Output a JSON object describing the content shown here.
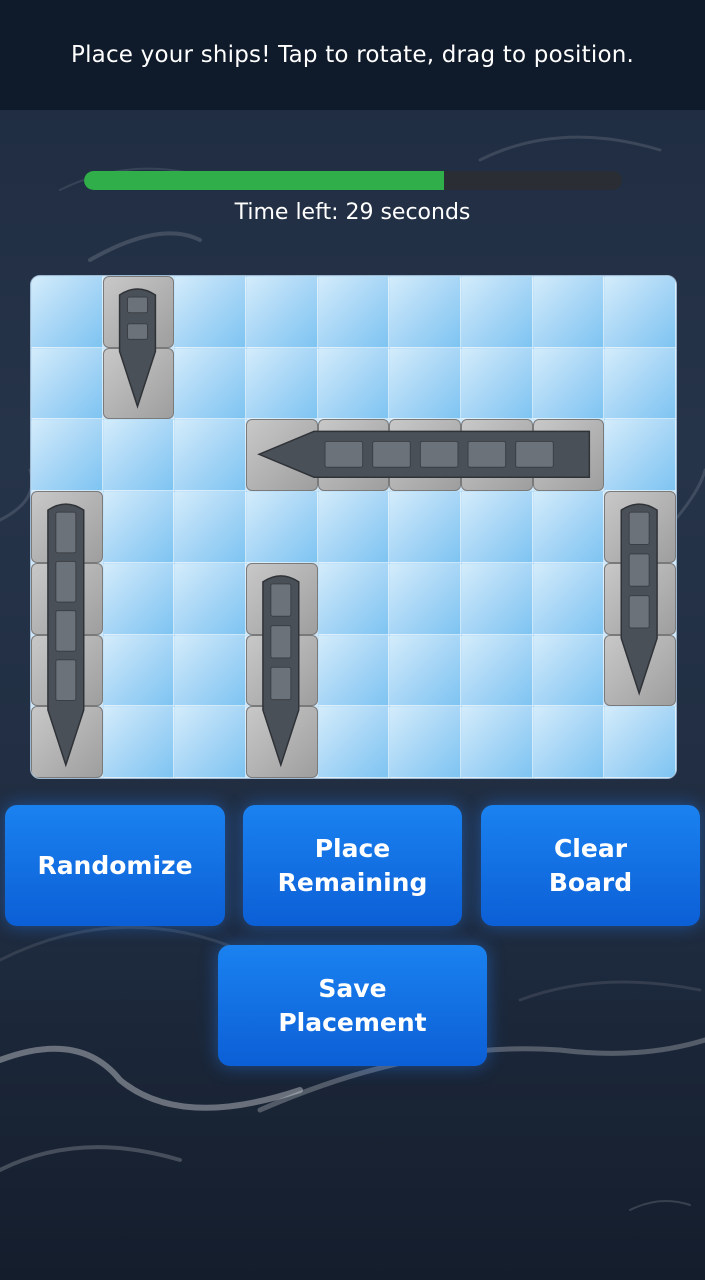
{
  "header": {
    "instruction": "Place your ships! Tap to rotate, drag to position."
  },
  "timer": {
    "label": "Time left: 29 seconds",
    "remaining_fraction": 0.67
  },
  "board": {
    "columns": 9,
    "rows": 7,
    "ships": [
      {
        "name": "patrol-boat",
        "icon": "gunboat-icon",
        "col": 1,
        "row": 0,
        "length": 2,
        "orientation": "vertical"
      },
      {
        "name": "battleship",
        "icon": "battleship-icon",
        "col": 3,
        "row": 2,
        "length": 5,
        "orientation": "horizontal"
      },
      {
        "name": "aircraft-carrier",
        "icon": "carrier-icon",
        "col": 0,
        "row": 3,
        "length": 4,
        "orientation": "vertical"
      },
      {
        "name": "destroyer",
        "icon": "destroyer-icon",
        "col": 3,
        "row": 4,
        "length": 3,
        "orientation": "vertical"
      },
      {
        "name": "submarine",
        "icon": "submarine-icon",
        "col": 8,
        "row": 3,
        "length": 3,
        "orientation": "vertical"
      }
    ]
  },
  "buttons": {
    "randomize": "Randomize",
    "place_remaining": "Place\nRemaining",
    "clear_board": "Clear\nBoard",
    "save_placement": "Save\nPlacement"
  },
  "colors": {
    "accent": "#1a82f0",
    "timer_fill": "#2fae4a",
    "topbar": "#0f1a2a"
  }
}
